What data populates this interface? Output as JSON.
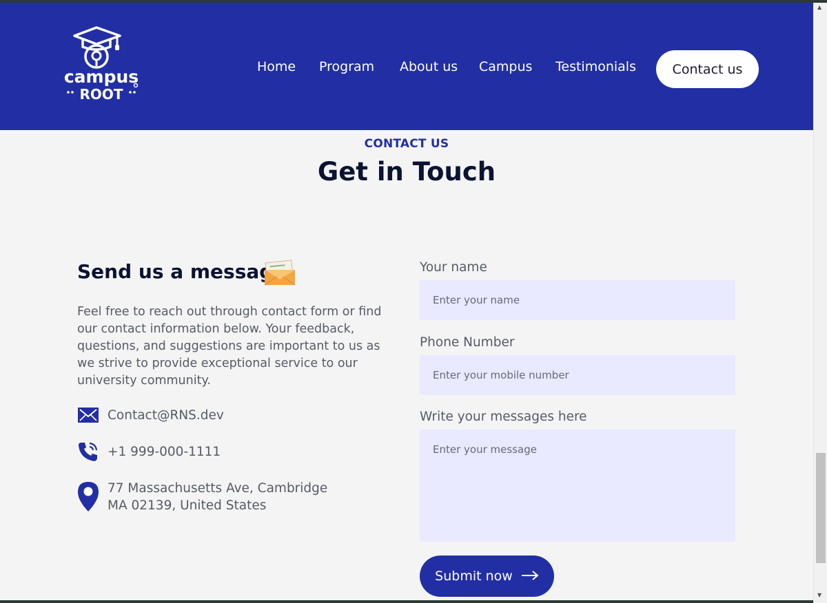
{
  "brand": {
    "line1": "campus",
    "line2": "ROOT"
  },
  "nav": {
    "items": [
      {
        "label": "Home"
      },
      {
        "label": "Program"
      },
      {
        "label": "About us"
      },
      {
        "label": "Campus"
      },
      {
        "label": "Testimonials"
      }
    ],
    "cta_label": "Contact us"
  },
  "section": {
    "eyebrow": "CONTACT US",
    "title": "Get in Touch"
  },
  "left": {
    "title": "Send us a message",
    "emoji_icon": "envelope-with-letter-icon",
    "description": "Feel free to reach out through contact form or find our contact information below. Your feedback, questions, and suggestions are important to us as we strive to provide exceptional service to our university community.",
    "email": "Contact@RNS.dev",
    "phone": "+1 999-000-1111",
    "address_line1": "77 Massachusetts Ave, Cambridge",
    "address_line2": "MA 02139, United States"
  },
  "form": {
    "name_label": "Your name",
    "name_placeholder": "Enter your name",
    "phone_label": "Phone Number",
    "phone_placeholder": "Enter your mobile number",
    "message_label": "Write your messages here",
    "message_placeholder": "Enter your message",
    "submit_label": "Submit now"
  },
  "colors": {
    "brand_blue": "#222fa4",
    "heading_dark": "#0b1331",
    "input_bg": "#e9e9ff",
    "page_bg": "#f4f4f4"
  }
}
